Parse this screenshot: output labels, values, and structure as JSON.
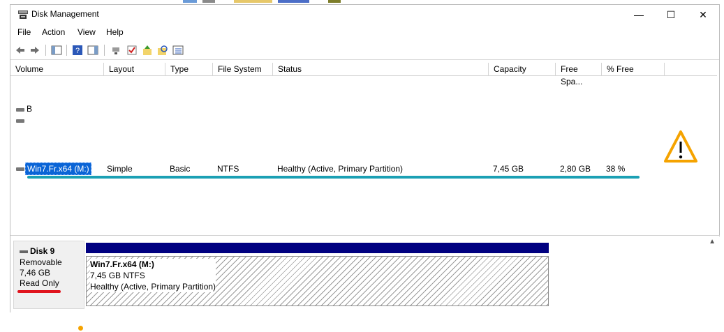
{
  "window": {
    "title": "Disk Management"
  },
  "window_controls": {
    "minimize": "—",
    "maximize": "☐",
    "close": "✕"
  },
  "menu": [
    "File",
    "Action",
    "View",
    "Help"
  ],
  "columns": [
    "Volume",
    "Layout",
    "Type",
    "File System",
    "Status",
    "Capacity",
    "Free Spa...",
    "% Free"
  ],
  "rows": {
    "partial_b": {
      "volume": "B"
    },
    "selected": {
      "volume": "Win7.Fr.x64 (M:)",
      "layout": "Simple",
      "type": "Basic",
      "file_system": "NTFS",
      "status": "Healthy (Active, Primary Partition)",
      "capacity": "7,45 GB",
      "free_space": "2,80 GB",
      "percent_free": "38 %"
    }
  },
  "disk": {
    "name": "Disk 9",
    "kind": "Removable",
    "size": "7,46 GB",
    "state": "Read Only"
  },
  "partition": {
    "label": "Win7.Fr.x64  (M:)",
    "size_fs": "7,45 GB NTFS",
    "status": "Healthy (Active, Primary Partition)"
  },
  "annotation_colors": {
    "teal_underline": "#1ba0b4",
    "red_underline": "#e0141e",
    "warning_orange": "#f5a300",
    "selection_blue": "#0a64d6",
    "partition_header": "#000080"
  }
}
